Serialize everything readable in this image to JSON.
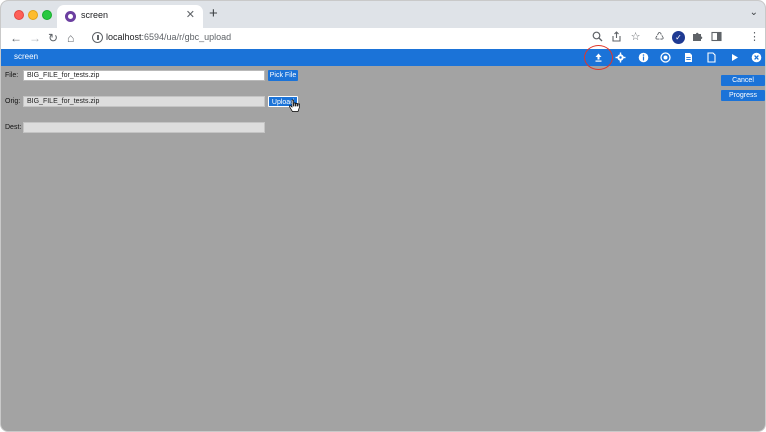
{
  "browser": {
    "tab_title": "screen",
    "tab_close": "✕",
    "new_tab": "+",
    "url_host": "localhost",
    "url_rest": ":6594/ua/r/gbc_upload"
  },
  "app": {
    "title": "screen"
  },
  "form": {
    "file_label": "File:",
    "file_value": "BIG_FILE_for_tests.zip",
    "pick_file_label": "Pick File",
    "orig_label": "Orig:",
    "orig_value": "BIG_FILE_for_tests.zip",
    "upload_label": "Upload",
    "dest_label": "Dest:",
    "dest_value": ""
  },
  "side_buttons": {
    "cancel_label": "Cancel",
    "progress_label": "Progress"
  },
  "colors": {
    "accent": "#1b73d8",
    "background": "#a3a3a3",
    "highlight": "#e0362a"
  }
}
